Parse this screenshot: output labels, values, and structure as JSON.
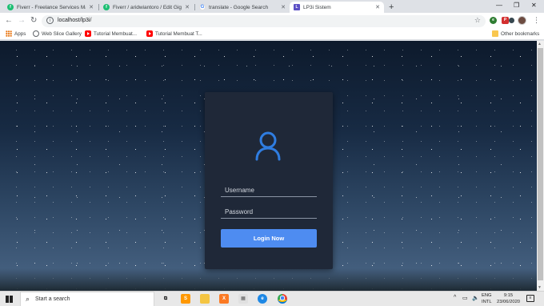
{
  "browser": {
    "tabs": [
      {
        "title": "Fiverr - Freelance Services Marke",
        "favicon": "fiverr-icon",
        "active": false
      },
      {
        "title": "Fiverr / aridwiantoro / Edit Gig",
        "favicon": "fiverr-icon",
        "active": false
      },
      {
        "title": "translate - Google Search",
        "favicon": "google-icon",
        "active": false
      },
      {
        "title": "LP3i Sistem",
        "favicon": "lp3i-icon",
        "active": true
      }
    ],
    "new_tab": "+",
    "window_controls": {
      "minimize": "—",
      "maximize": "❐",
      "close": "✕"
    },
    "address": "localhost/lp3i/",
    "bookmarks": [
      {
        "label": "Apps",
        "icon": "apps-icon"
      },
      {
        "label": "Web Slice Gallery",
        "icon": "globe-icon"
      },
      {
        "label": "Tutorial Membuat...",
        "icon": "youtube-icon"
      },
      {
        "label": "Tutorial Membuat T...",
        "icon": "youtube-icon"
      }
    ],
    "other_bookmarks": "Other bookmarks"
  },
  "login": {
    "username_placeholder": "Username",
    "password_placeholder": "Password",
    "button_label": "Login Now",
    "accent_color": "#4e8cf1",
    "icon": "user-icon"
  },
  "taskbar": {
    "search_placeholder": "Start a search",
    "lang_top": "ENG",
    "lang_bottom": "INTL",
    "time": "9:15",
    "date": "23/06/2020",
    "tray_chevron": "^"
  }
}
